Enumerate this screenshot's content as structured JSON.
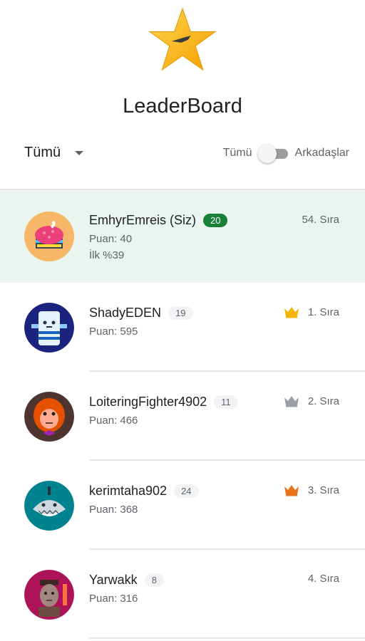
{
  "header": {
    "title": "LeaderBoard",
    "star_icon": "star-icon"
  },
  "filters": {
    "scope_label": "Tümü",
    "toggle_left_label": "Tümü",
    "toggle_right_label": "Arkadaşlar",
    "toggle_on": false
  },
  "colors": {
    "level_me_badge": "#188038",
    "me_row_bg": "#eaf5f0",
    "gold": "#f4b400",
    "silver": "#9aa0a6",
    "bronze": "#e8711a"
  },
  "players": [
    {
      "name": "EmhyrEmreis (Siz)",
      "level": "20",
      "points": "Puan: 40",
      "percent": "İlk %39",
      "rank": "54. Sıra",
      "avatar": "cupcake-avatar",
      "crown": ""
    },
    {
      "name": "ShadyEDEN",
      "level": "19",
      "points": "Puan: 595",
      "rank": "1. Sıra",
      "avatar": "robot-avatar",
      "crown": "gold-crown-icon"
    },
    {
      "name": "LoiteringFighter4902",
      "level": "11",
      "points": "Puan: 466",
      "rank": "2. Sıra",
      "avatar": "orangutan-avatar",
      "crown": "silver-crown-icon"
    },
    {
      "name": "kerimtaha902",
      "level": "24",
      "points": "Puan: 368",
      "rank": "3. Sıra",
      "avatar": "shark-avatar",
      "crown": "bronze-crown-icon"
    },
    {
      "name": "Yarwakk",
      "level": "8",
      "points": "Puan: 316",
      "rank": "4. Sıra",
      "avatar": "warrior-avatar",
      "crown": ""
    }
  ]
}
